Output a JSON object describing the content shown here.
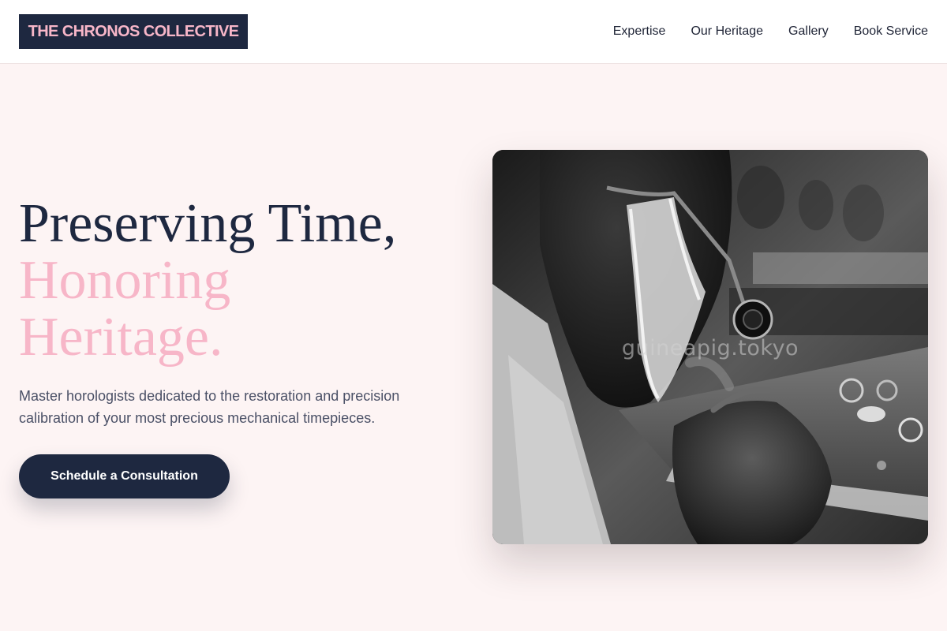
{
  "header": {
    "brand": "THE CHRONOS COLLECTIVE",
    "nav": [
      {
        "label": "Expertise"
      },
      {
        "label": "Our Heritage"
      },
      {
        "label": "Gallery"
      },
      {
        "label": "Book Service"
      }
    ]
  },
  "hero": {
    "heading_line1": "Preserving Time,",
    "heading_accent": "Honoring Heritage.",
    "subtext": "Master horologists dedicated to the restoration and precision calibration of your most precious mechanical timepieces.",
    "cta_label": "Schedule a Consultation",
    "image_alt": "Watchmaker with loupe working at a bench",
    "watermark": "guineapig.tokyo"
  },
  "colors": {
    "navy": "#1e2840",
    "pink": "#f7b6c8",
    "background": "#fdf4f4"
  }
}
